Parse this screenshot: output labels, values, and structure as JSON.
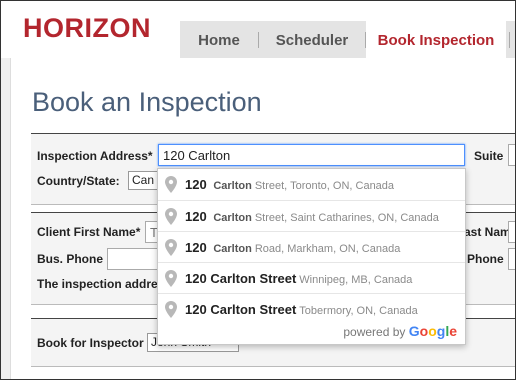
{
  "brand": {
    "logo_text": "HORIZON",
    "color": "#b3262e"
  },
  "nav": {
    "items": [
      {
        "label": "Home"
      },
      {
        "label": "Scheduler"
      },
      {
        "label": "Book Inspection",
        "active": true
      }
    ]
  },
  "page": {
    "title": "Book an Inspection"
  },
  "address_section": {
    "address_label": "Inspection Address*",
    "address_value": "120 Carlton",
    "suite_label": "Suite",
    "country_label": "Country/State:",
    "country_value": "Can"
  },
  "client_section": {
    "first_name_label": "Client First Name*",
    "first_name_placeholder": "Ty",
    "last_name_label": "ast Name",
    "bus_phone_label": "Bus. Phone",
    "phone_label": "Phone",
    "inspection_address_text": "The inspection addre"
  },
  "inspector_section": {
    "label": "Book for Inspector",
    "selected": "John Smith"
  },
  "autocomplete": {
    "suggestions": [
      {
        "number": "120",
        "street": "Carlton",
        "street_suffix": "Street, Toronto, ON, Canada",
        "bold": false
      },
      {
        "number": "120",
        "street": "Carlton",
        "street_suffix": "Street, Saint Catharines, ON, Canada",
        "bold": false
      },
      {
        "number": "120",
        "street": "Carlton",
        "street_suffix": "Road, Markham, ON, Canada",
        "bold": false
      },
      {
        "number": "120",
        "street": "Carlton Street",
        "street_suffix": "Winnipeg, MB, Canada",
        "bold": true
      },
      {
        "number": "120",
        "street": "Carlton Street",
        "street_suffix": "Tobermory, ON, Canada",
        "bold": true
      }
    ],
    "powered_by": "powered by",
    "google": [
      "G",
      "o",
      "o",
      "g",
      "l",
      "e"
    ]
  }
}
